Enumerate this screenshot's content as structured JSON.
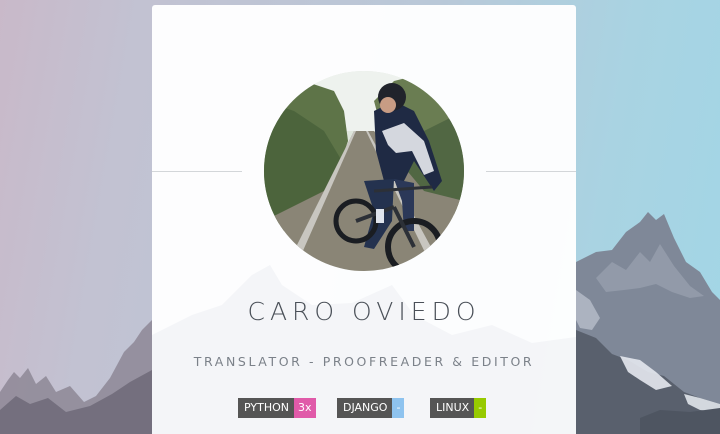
{
  "profile": {
    "name": "CARO OVIEDO",
    "role": "TRANSLATOR - PROOFREADER & EDITOR",
    "avatar_alt": "avatar photo of cyclist on railway tracks"
  },
  "badges": [
    {
      "label": "PYTHON",
      "value": "3x",
      "color": "#e05aa9"
    },
    {
      "label": "DJANGO",
      "value": "-",
      "color": "#8ec3ef"
    },
    {
      "label": "LINUX",
      "value": "-",
      "color": "#97ca00"
    }
  ],
  "colors": {
    "card_background": "#ffffff",
    "title_text": "#4a5058",
    "subtitle_text": "#7b8189",
    "badge_label_bg": "#555555"
  }
}
